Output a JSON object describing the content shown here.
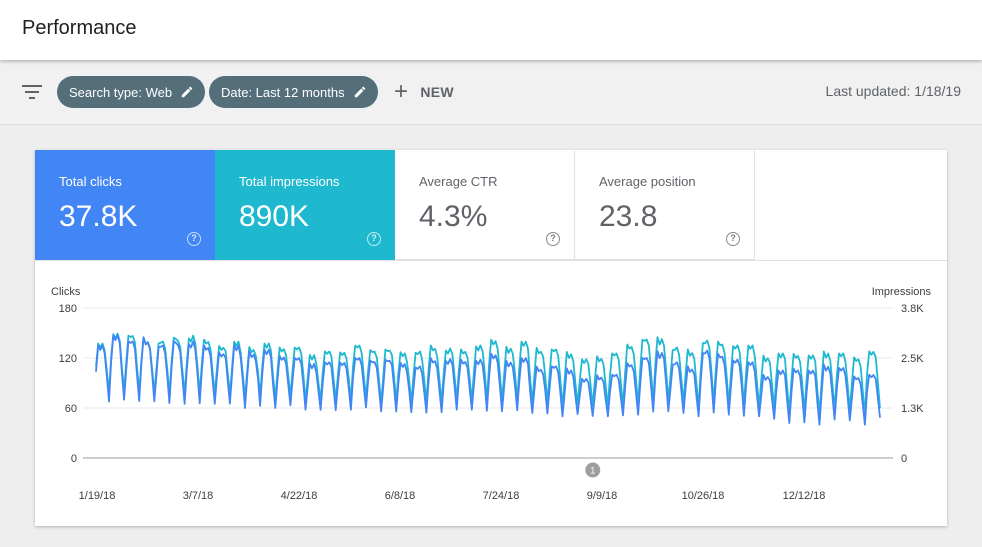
{
  "page": {
    "title": "Performance"
  },
  "toolbar": {
    "chips": [
      {
        "label": "Search type: Web"
      },
      {
        "label": "Date: Last 12 months"
      }
    ],
    "new_label": "NEW",
    "last_updated": "Last updated: 1/18/19"
  },
  "metrics": [
    {
      "label": "Total clicks",
      "value": "37.8K"
    },
    {
      "label": "Total impressions",
      "value": "890K"
    },
    {
      "label": "Average CTR",
      "value": "4.3%"
    },
    {
      "label": "Average position",
      "value": "23.8"
    }
  ],
  "help_glyph": "?",
  "colors": {
    "clicks": "#4285f4",
    "impressions": "#1fb9cf",
    "chip": "#546e7a",
    "annotation": "#9e9e9e"
  },
  "chart_data": {
    "type": "line",
    "y_left_label": "Clicks",
    "y_right_label": "Impressions",
    "y_left_ticks": [
      "180",
      "120",
      "60",
      "0"
    ],
    "y_left_ylim": [
      0,
      180
    ],
    "y_right_ticks": [
      "3.8K",
      "2.5K",
      "1.3K",
      "0"
    ],
    "y_right_ylim": [
      0,
      3800
    ],
    "x_tick_labels": [
      "1/19/18",
      "3/7/18",
      "4/22/18",
      "6/8/18",
      "7/24/18",
      "9/9/18",
      "10/26/18",
      "12/12/18"
    ],
    "x_range": [
      "1/19/18",
      "1/17/19"
    ],
    "annotation": {
      "label": "1",
      "at_day": 230
    },
    "grid": true,
    "weekly_pattern": {
      "description_of_shape": "daily values with strong weekly seasonality (weekday highs, weekend lows)",
      "days": 364
    },
    "series": [
      {
        "name": "Clicks",
        "axis": "left",
        "weekday_high": [
          135,
          150,
          140,
          145,
          135,
          140,
          140,
          135,
          130,
          135,
          130,
          130,
          125,
          120,
          115,
          115,
          118,
          120,
          120,
          118,
          115,
          110,
          120,
          120,
          118,
          120,
          125,
          118,
          120,
          110,
          110,
          108,
          95,
          100,
          100,
          115,
          120,
          130,
          115,
          110,
          130,
          125,
          120,
          115,
          100,
          105,
          110,
          105,
          112,
          108,
          100,
          100
        ],
        "weekend_low": [
          65,
          70,
          65,
          68,
          65,
          65,
          65,
          65,
          62,
          60,
          62,
          60,
          60,
          58,
          56,
          55,
          58,
          58,
          56,
          55,
          55,
          52,
          55,
          55,
          58,
          55,
          56,
          55,
          54,
          52,
          50,
          50,
          48,
          50,
          50,
          52,
          55,
          56,
          52,
          50,
          52,
          52,
          50,
          50,
          45,
          42,
          40,
          40,
          45,
          45,
          40,
          48
        ]
      },
      {
        "name": "Impressions",
        "axis": "right",
        "weekday_high": [
          2900,
          3200,
          3100,
          3050,
          2950,
          3050,
          3100,
          3000,
          2900,
          2950,
          2850,
          2900,
          2850,
          2800,
          2650,
          2700,
          2750,
          2850,
          2800,
          2750,
          2700,
          2700,
          2850,
          2800,
          2750,
          2900,
          3000,
          2850,
          2950,
          2800,
          2750,
          2700,
          2500,
          2600,
          2650,
          2900,
          3000,
          3100,
          2800,
          2750,
          3000,
          2950,
          2900,
          2850,
          2600,
          2650,
          2700,
          2600,
          2700,
          2650,
          2600,
          2700
        ],
        "weekend_low": [
          1600,
          1700,
          1600,
          1650,
          1600,
          1600,
          1600,
          1600,
          1550,
          1500,
          1550,
          1500,
          1500,
          1450,
          1400,
          1400,
          1450,
          1450,
          1400,
          1400,
          1400,
          1350,
          1400,
          1400,
          1450,
          1400,
          1450,
          1400,
          1400,
          1350,
          1300,
          1300,
          1250,
          1300,
          1300,
          1350,
          1400,
          1450,
          1350,
          1300,
          1350,
          1350,
          1300,
          1300,
          1200,
          1150,
          1100,
          1100,
          1200,
          1200,
          1100,
          1250
        ]
      }
    ]
  }
}
